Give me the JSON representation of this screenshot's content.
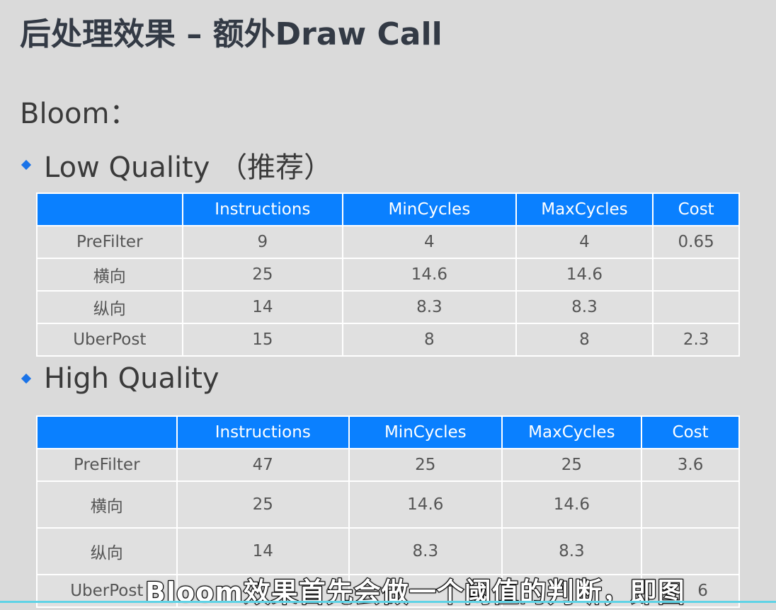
{
  "title": "后处理效果 – 额外Draw Call",
  "section": "Bloom：",
  "low": {
    "heading": "Low Quality （推荐）",
    "headers": [
      "",
      "Instructions",
      "MinCycles",
      "MaxCycles",
      "Cost"
    ],
    "rows": [
      [
        "PreFilter",
        "9",
        "4",
        "4",
        "0.65"
      ],
      [
        "横向",
        "25",
        "14.6",
        "14.6",
        ""
      ],
      [
        "纵向",
        "14",
        "8.3",
        "8.3",
        ""
      ],
      [
        "UberPost",
        "15",
        "8",
        "8",
        "2.3"
      ]
    ]
  },
  "high": {
    "heading": "High Quality",
    "headers": [
      "",
      "Instructions",
      "MinCycles",
      "MaxCycles",
      "Cost"
    ],
    "rows": [
      [
        "PreFilter",
        "47",
        "25",
        "25",
        "3.6"
      ],
      [
        "横向",
        "25",
        "14.6",
        "14.6",
        ""
      ],
      [
        "纵向",
        "14",
        "8.3",
        "8.3",
        ""
      ],
      [
        "UberPost",
        "",
        "",
        "",
        "6"
      ]
    ]
  },
  "subtitle": "Bloom效果首先会做一个阈值的判断，即图"
}
